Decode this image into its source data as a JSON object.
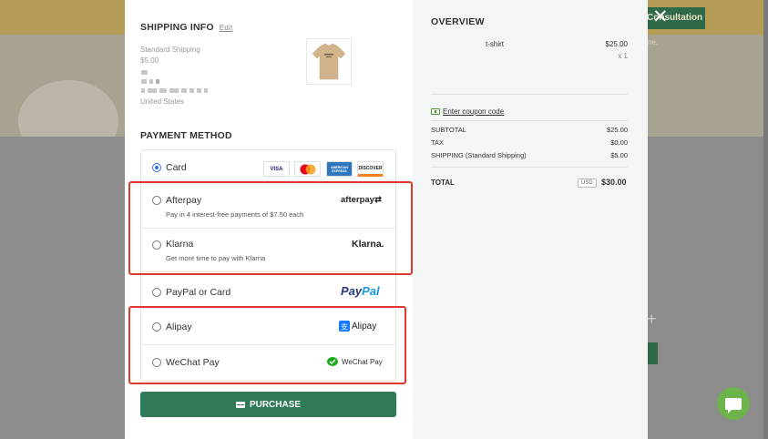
{
  "background": {
    "consultation_label": "Consultation",
    "chat_icon": "chat-bubble-icon"
  },
  "modal": {
    "close_icon": "close-icon",
    "shipping": {
      "title": "SHIPPING INFO",
      "edit_label": "Edit",
      "method": "Standard Shipping",
      "cost": "$5.00",
      "country": "United States"
    },
    "payment": {
      "title": "PAYMENT METHOD",
      "options": [
        {
          "label": "Card",
          "selected": true
        },
        {
          "label": "Afterpay",
          "sub": "Pay in 4 interest-free payments of $7.50 each",
          "logo": "afterpay"
        },
        {
          "label": "Klarna",
          "sub": "Get more time to pay with Klarna",
          "logo": "Klarna."
        },
        {
          "label": "PayPal or Card",
          "logo": "PayPal"
        },
        {
          "label": "Alipay",
          "logo": "Alipay"
        },
        {
          "label": "WeChat Pay",
          "logo": "WeChat Pay"
        }
      ],
      "card_logos": [
        "VISA",
        "MasterCard",
        "AMERICAN EXPRESS",
        "DISCOVER"
      ]
    },
    "purchase_label": "PURCHASE"
  },
  "overview": {
    "title": "OVERVIEW",
    "item": {
      "name": "t-shirt",
      "price": "$25.00",
      "qty": "x 1"
    },
    "coupon_label": "Enter coupon code",
    "subtotal_label": "SUBTOTAL",
    "subtotal": "$25.00",
    "tax_label": "TAX",
    "tax": "$0.00",
    "shipping_label": "SHIPPING (Standard Shipping)",
    "shipping": "$5.00",
    "total_label": "TOTAL",
    "currency": "USD",
    "total": "$30.00"
  },
  "colors": {
    "accent_green": "#2f7a57",
    "highlight_red": "#e03a2f",
    "radio_blue": "#2f6fde"
  }
}
